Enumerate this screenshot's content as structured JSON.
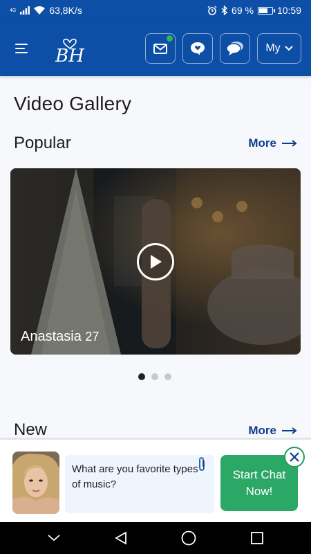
{
  "status_bar": {
    "network_type": "4G",
    "speed": "63,8K/s",
    "battery_percent": "69 %",
    "battery_level": 0.69,
    "time": "10:59",
    "icons": [
      "signal-icon",
      "wifi-icon",
      "alarm-icon",
      "bluetooth-icon",
      "battery-icon"
    ]
  },
  "header": {
    "logo_text": "BH",
    "my_label": "My",
    "mail_has_unread": true,
    "accent_color": "#0d4ea6"
  },
  "page": {
    "title": "Video Gallery"
  },
  "popular": {
    "title": "Popular",
    "more_label": "More",
    "video": {
      "name": "Anastasia",
      "age": "27"
    },
    "carousel_pages": 3,
    "active_page": 1
  },
  "new_section": {
    "title": "New",
    "more_label": "More"
  },
  "chat": {
    "message": "What are you favorite types of music?",
    "start_label": "Start Chat Now!",
    "button_color": "#2ca866"
  }
}
